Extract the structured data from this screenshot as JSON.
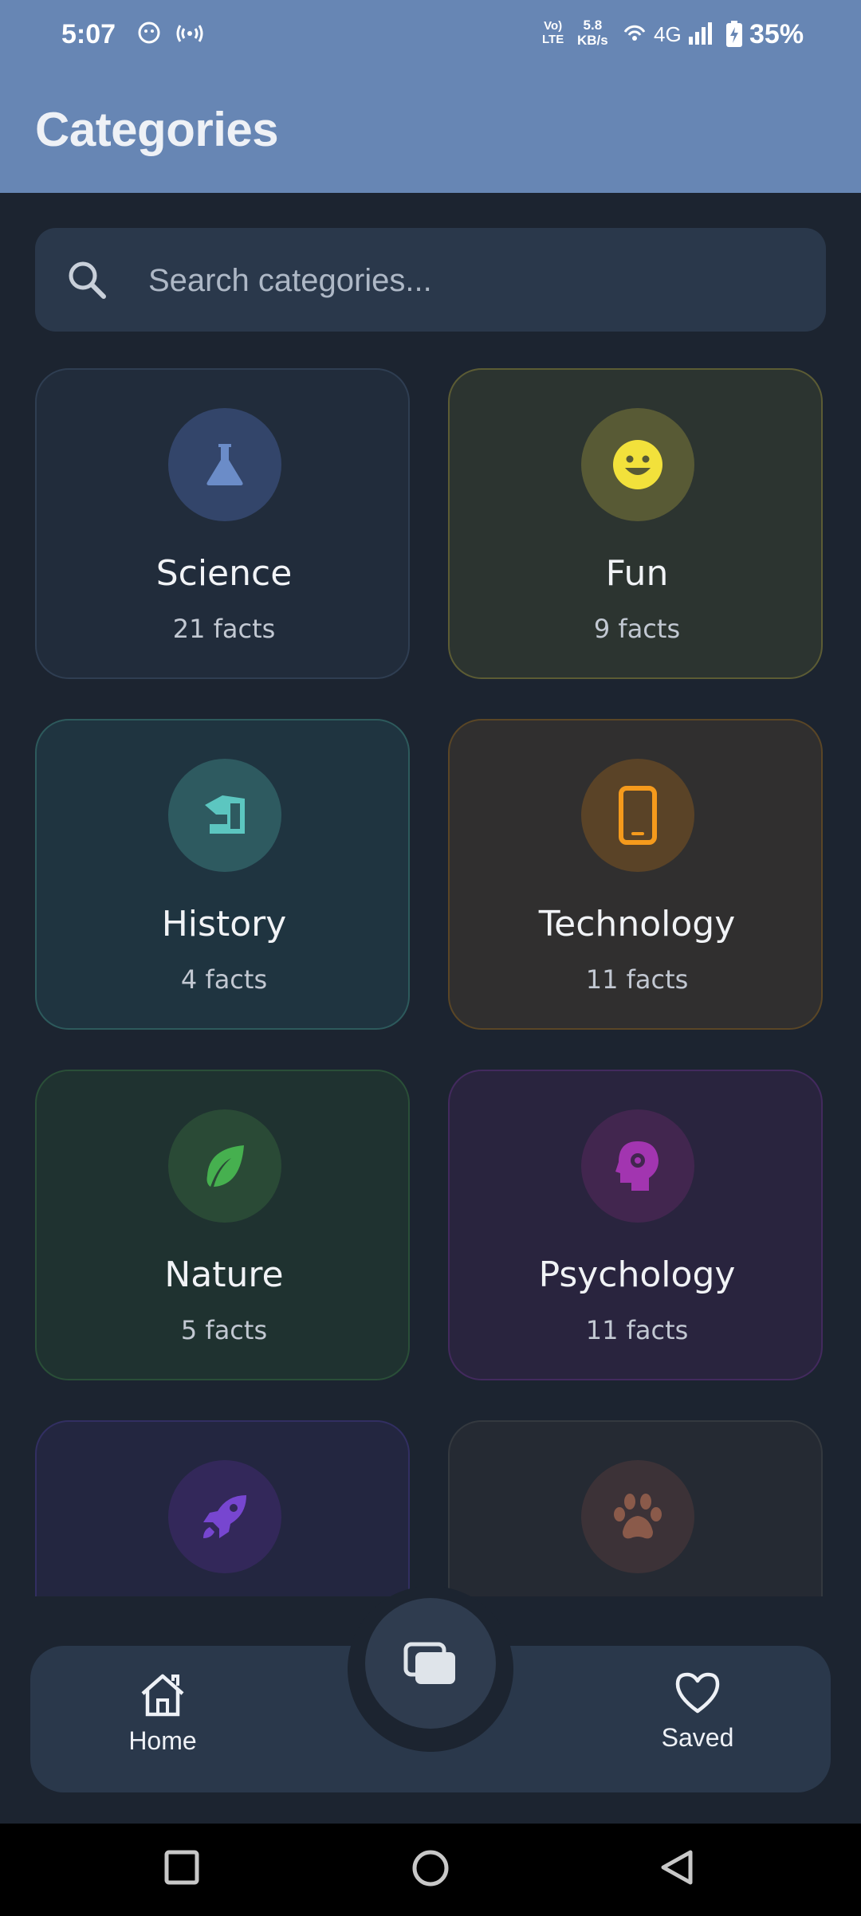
{
  "status_bar": {
    "time": "5:07",
    "network_line1": "Vo)",
    "network_line2": "LTE",
    "speed_value": "5.8",
    "speed_unit": "KB/s",
    "network_type": "4G",
    "battery": "35%"
  },
  "app_bar": {
    "title": "Categories",
    "color": "#6786b4"
  },
  "search": {
    "placeholder": "Search categories...",
    "value": ""
  },
  "categories": [
    {
      "name": "Science",
      "count": "21 facts",
      "icon": "flask-icon",
      "accent": "#6b8cc8"
    },
    {
      "name": "Fun",
      "count": "9 facts",
      "icon": "smiley-icon",
      "accent": "#f2e13b"
    },
    {
      "name": "History",
      "count": "4 facts",
      "icon": "history-edu-icon",
      "accent": "#5cc6c0"
    },
    {
      "name": "Technology",
      "count": "11 facts",
      "icon": "phone-icon",
      "accent": "#f59a1c"
    },
    {
      "name": "Nature",
      "count": "5 facts",
      "icon": "leaf-icon",
      "accent": "#46b04f"
    },
    {
      "name": "Psychology",
      "count": "11 facts",
      "icon": "brain-head-icon",
      "accent": "#a235b0"
    },
    {
      "name": "",
      "count": "",
      "icon": "rocket-icon",
      "accent": "#7746d0"
    },
    {
      "name": "",
      "count": "",
      "icon": "paw-icon",
      "accent": "#8a5a4a"
    }
  ],
  "bottom_nav": {
    "home_label": "Home",
    "saved_label": "Saved",
    "center_icon": "cards-icon"
  }
}
